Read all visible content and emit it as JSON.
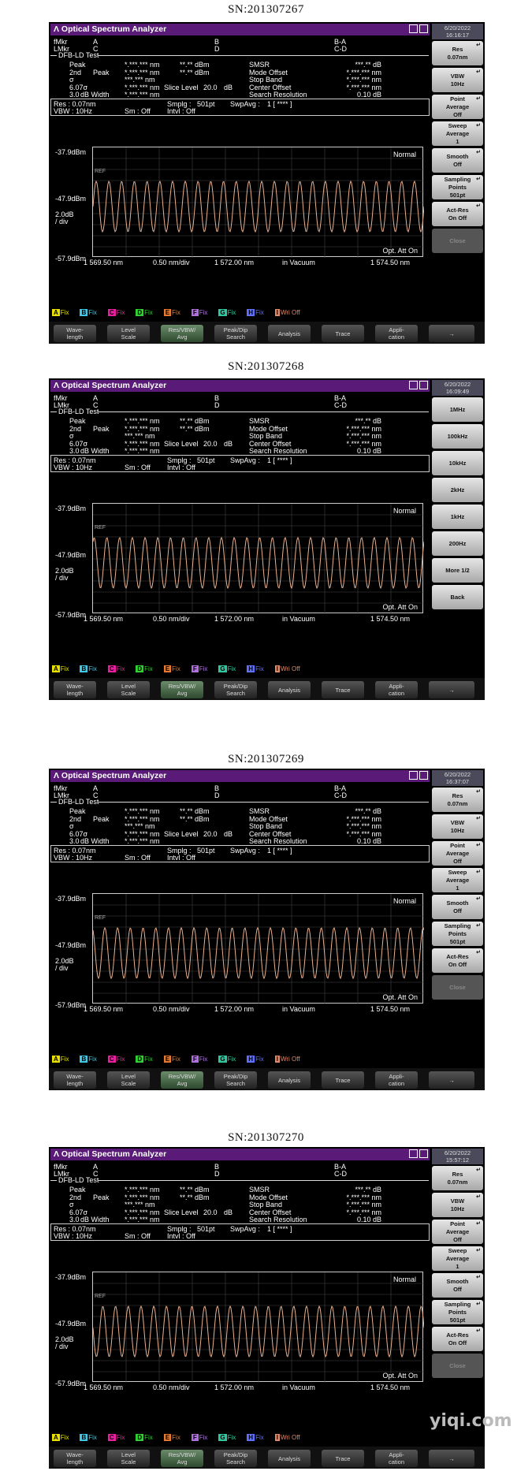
{
  "title": "Optical Spectrum Analyzer",
  "markers": {
    "fmkr": "fMkr",
    "lmkr": "LMkr",
    "a": "A",
    "b": "B",
    "c": "C",
    "d": "D",
    "ba": "B-A",
    "cd": "C-D"
  },
  "test_label": "DFB-LD Test",
  "results": {
    "left_labels": [
      "Peak",
      "2nd",
      "σ",
      "6.07σ",
      "3.0"
    ],
    "peak_label": "Peak",
    "db_width": "dB Width",
    "nm_vals": [
      "*.***.*** nm",
      "*.***.*** nm",
      "***.*** nm",
      "*.***.*** nm",
      "*.***.*** nm"
    ],
    "dbm_vals": [
      "**.** dBm",
      "**.** dBm"
    ],
    "slice_level": "Slice Level",
    "slice_val": "20.0",
    "slice_unit": "dB",
    "right_labels": [
      "SMSR",
      "Mode Offset",
      "Stop Band",
      "Center Offset",
      "Search Resolution"
    ],
    "right_vals": [
      "***.** dB",
      "*.***.*** nm",
      "*.***.*** nm",
      "*.***.*** nm",
      "0.10 dB"
    ]
  },
  "params": {
    "res": "Res : 0.07nm",
    "vbw": "VBW : 10Hz",
    "smplg": "Smplg :",
    "smplg_v": "501pt",
    "swpavg": "SwpAvg :",
    "swpavg_v": "1 [ **** ]",
    "sm": "Sm : Off",
    "intvl": "Intvl : Off"
  },
  "graph": {
    "mode": "Normal",
    "ref": "REF",
    "top": "-37.9dBm",
    "mid": "-47.9dBm",
    "scale": "2.0dB",
    "div": "/ div",
    "bottom": "-57.9dBm",
    "att": "Opt. Att On",
    "start": "1 569.50 nm",
    "perdiv": "0.50 nm/div",
    "center": "1 572.00 nm",
    "vacuum": "in Vacuum",
    "stop": "1 574.50 nm"
  },
  "traces": [
    {
      "b": "A",
      "t": "Fix",
      "c": "#e8e000"
    },
    {
      "b": "B",
      "t": "Fix",
      "c": "#40c8e8"
    },
    {
      "b": "C",
      "t": "Fix",
      "c": "#e820a0"
    },
    {
      "b": "D",
      "t": "Fix",
      "c": "#30d030"
    },
    {
      "b": "E",
      "t": "Fix",
      "c": "#e87a30"
    },
    {
      "b": "F",
      "t": "Fix",
      "c": "#b070e0"
    },
    {
      "b": "G",
      "t": "Fix",
      "c": "#30c8a0"
    },
    {
      "b": "H",
      "t": "Fix",
      "c": "#6070ff"
    },
    {
      "b": "I",
      "t": "Wri Off",
      "c": "#e08a6a"
    }
  ],
  "fkeys": [
    [
      "Wave-",
      "length"
    ],
    [
      "Level",
      "Scale"
    ],
    [
      "Res/VBW/",
      "Avg"
    ],
    [
      "Peak/Dip",
      "Search"
    ],
    [
      "Analysis",
      ""
    ],
    [
      "Trace",
      ""
    ],
    [
      "Appli-",
      "cation"
    ],
    [
      "→",
      ""
    ]
  ],
  "screens": [
    {
      "sn": "SN:201307267",
      "date": [
        "6/20/2022",
        "16:16:17"
      ],
      "menu": "A"
    },
    {
      "sn": "SN:201307268",
      "date": [
        "6/20/2022",
        "16:09:49"
      ],
      "menu": "B"
    },
    {
      "sn": "SN:201307269",
      "date": [
        "6/20/2022",
        "16:37:07"
      ],
      "menu": "A"
    },
    {
      "sn": "SN:201307270",
      "date": [
        "6/20/2022",
        "15:57:12"
      ],
      "menu": "A"
    }
  ],
  "menus": {
    "A": [
      {
        "l": [
          "Res",
          "0.07nm"
        ]
      },
      {
        "l": [
          "VBW",
          "10Hz"
        ]
      },
      {
        "l": [
          "Point",
          "Average",
          "Off"
        ]
      },
      {
        "l": [
          "Sweep",
          "Average",
          "1"
        ]
      },
      {
        "l": [
          "Smooth",
          "Off"
        ]
      },
      {
        "l": [
          "Sampling",
          "Points",
          "501pt"
        ]
      },
      {
        "l": [
          "Act-Res",
          "On  Off"
        ]
      },
      {
        "l": [
          "Close"
        ],
        "close": true
      }
    ],
    "B": [
      {
        "l": [
          "1MHz"
        ]
      },
      {
        "l": [
          "100kHz"
        ]
      },
      {
        "l": [
          "10kHz"
        ]
      },
      {
        "l": [
          "2kHz"
        ]
      },
      {
        "l": [
          "1kHz"
        ]
      },
      {
        "l": [
          "200Hz"
        ]
      },
      {
        "l": [
          "More 1/2"
        ]
      },
      {
        "l": [
          "Back"
        ]
      }
    ]
  },
  "watermark": "yiqi.com"
}
